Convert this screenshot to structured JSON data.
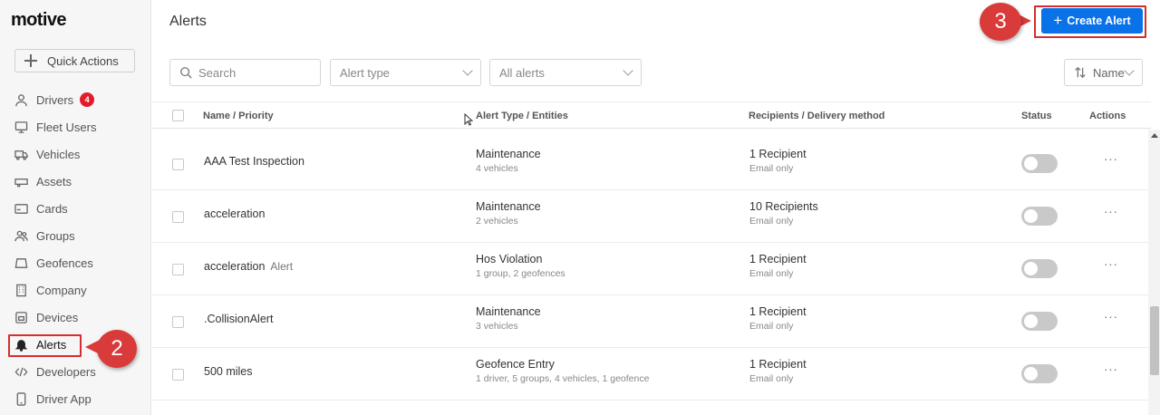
{
  "sidebar": {
    "logo": "motive",
    "quick_actions": "Quick Actions",
    "items": [
      {
        "label": "Drivers",
        "icon": "person-icon",
        "badge": "4"
      },
      {
        "label": "Fleet Users",
        "icon": "monitor-icon"
      },
      {
        "label": "Vehicles",
        "icon": "truck-icon"
      },
      {
        "label": "Assets",
        "icon": "trailer-icon"
      },
      {
        "label": "Cards",
        "icon": "card-icon"
      },
      {
        "label": "Groups",
        "icon": "group-icon"
      },
      {
        "label": "Geofences",
        "icon": "geofence-icon"
      },
      {
        "label": "Company",
        "icon": "building-icon"
      },
      {
        "label": "Devices",
        "icon": "device-icon"
      },
      {
        "label": "Alerts",
        "icon": "bell-icon",
        "active": true
      },
      {
        "label": "Developers",
        "icon": "code-icon"
      },
      {
        "label": "Driver App",
        "icon": "phone-icon"
      }
    ]
  },
  "annotations": {
    "step2": "2",
    "step3": "3",
    "color": "#d93a3a"
  },
  "header": {
    "title": "Alerts",
    "create_button": "Create Alert",
    "accent": "#0a72e8"
  },
  "filters": {
    "search_placeholder": "Search",
    "alert_type": "Alert type",
    "all_alerts": "All alerts",
    "sort": "Name"
  },
  "table": {
    "headers": {
      "name": "Name / Priority",
      "type": "Alert Type / Entities",
      "recipients": "Recipients / Delivery method",
      "status": "Status",
      "actions": "Actions"
    },
    "rows": [
      {
        "name": "AAA Test Inspection",
        "tag": "",
        "type": "Maintenance",
        "entities": "4 vehicles",
        "recipients": "1 Recipient",
        "method": "Email only",
        "status": "off"
      },
      {
        "name": "acceleration",
        "tag": "",
        "type": "Maintenance",
        "entities": "2 vehicles",
        "recipients": "10 Recipients",
        "method": "Email only",
        "status": "off"
      },
      {
        "name": "acceleration",
        "tag": "Alert",
        "type": "Hos Violation",
        "entities": "1 group, 2 geofences",
        "recipients": "1 Recipient",
        "method": "Email only",
        "status": "off"
      },
      {
        "name": ".CollisionAlert",
        "tag": "",
        "type": "Maintenance",
        "entities": "3 vehicles",
        "recipients": "1 Recipient",
        "method": "Email only",
        "status": "off"
      },
      {
        "name": "500 miles",
        "tag": "",
        "type": "Geofence Entry",
        "entities": "1 driver, 5 groups, 4 vehicles, 1 geofence",
        "recipients": "1 Recipient",
        "method": "Email only",
        "status": "off"
      }
    ]
  }
}
